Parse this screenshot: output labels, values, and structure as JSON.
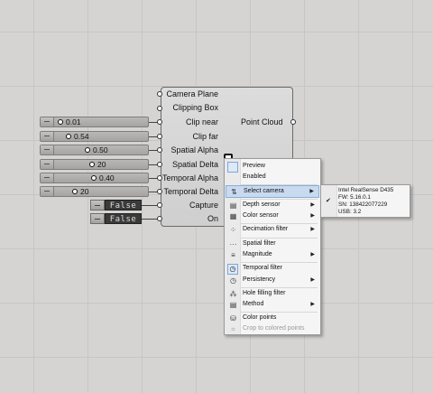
{
  "component": {
    "inputs": [
      "Camera Plane",
      "Clipping Box",
      "Clip near",
      "Clip far",
      "Spatial Alpha",
      "Spatial Delta",
      "Temporal Alpha",
      "Temporal Delta",
      "Capture",
      "On"
    ],
    "output": "Point Cloud"
  },
  "sliders": [
    {
      "value": "0.01"
    },
    {
      "value": "0.54"
    },
    {
      "value": "0.50"
    },
    {
      "value": "20"
    },
    {
      "value": "0.40"
    },
    {
      "value": "20"
    }
  ],
  "toggles": [
    {
      "value": "False"
    },
    {
      "value": "False"
    }
  ],
  "menu": {
    "items": [
      {
        "label": "Preview",
        "icon": "preview-icon"
      },
      {
        "label": "Enabled",
        "icon": "enabled-icon"
      },
      {
        "label": "Select camera",
        "icon": "camera-icon",
        "submenu": true,
        "selected": true
      },
      {
        "label": "Depth sensor",
        "icon": "depth-sensor-icon",
        "submenu": true
      },
      {
        "label": "Color sensor",
        "icon": "color-sensor-icon",
        "submenu": true
      },
      {
        "label": "Decimation filter",
        "icon": "decimation-icon",
        "submenu": true
      },
      {
        "label": "Spatial filter",
        "icon": "spatial-filter-icon"
      },
      {
        "label": "Magnitude",
        "icon": "magnitude-icon",
        "submenu": true
      },
      {
        "label": "Temporal filter",
        "icon": "temporal-filter-icon"
      },
      {
        "label": "Persistency",
        "icon": "persistency-icon",
        "submenu": true
      },
      {
        "label": "Hole filling filter",
        "icon": "hole-filling-icon"
      },
      {
        "label": "Method",
        "icon": "method-icon",
        "submenu": true
      },
      {
        "label": "Color points",
        "icon": "color-points-icon"
      },
      {
        "label": "Crop to colored points",
        "icon": "crop-icon",
        "disabled": true
      }
    ]
  },
  "submenu": {
    "camera": {
      "name": "Intel RealSense D435",
      "fw": "FW: 5.16.0.1",
      "sn": "SN: 138422077229",
      "usb": "USB: 3.2"
    }
  }
}
